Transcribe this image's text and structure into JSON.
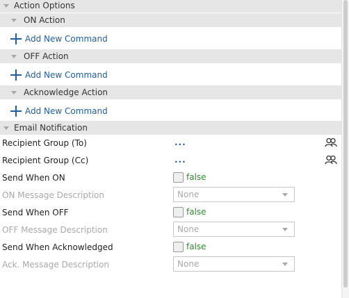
{
  "sections": {
    "action_options": "Action Options",
    "on_action": "ON Action",
    "off_action": "OFF Action",
    "ack_action": "Acknowledge Action",
    "email_notification": "Email Notification"
  },
  "add_command_label": "Add New Command",
  "properties": {
    "recipient_to": {
      "label": "Recipient Group (To)",
      "value": "..."
    },
    "recipient_cc": {
      "label": "Recipient Group (Cc)",
      "value": "..."
    },
    "send_on": {
      "label": "Send When ON",
      "value": "false"
    },
    "on_msg": {
      "label": "ON Message Description",
      "value": "None"
    },
    "send_off": {
      "label": "Send When OFF",
      "value": "false"
    },
    "off_msg": {
      "label": "OFF Message Description",
      "value": "None"
    },
    "send_ack": {
      "label": "Send When Acknowledged",
      "value": "false"
    },
    "ack_msg": {
      "label": "Ack. Message Description",
      "value": "None"
    }
  },
  "icons": {
    "expand": "triangle-down-icon",
    "add": "plus-icon",
    "group": "user-group-icon",
    "dropdown": "chevron-down-icon"
  },
  "colors": {
    "link": "#1f5d9c",
    "false_value": "#2e8b2e",
    "header_bg": "#e6e6e6",
    "disabled_text": "#a9a9a9"
  }
}
